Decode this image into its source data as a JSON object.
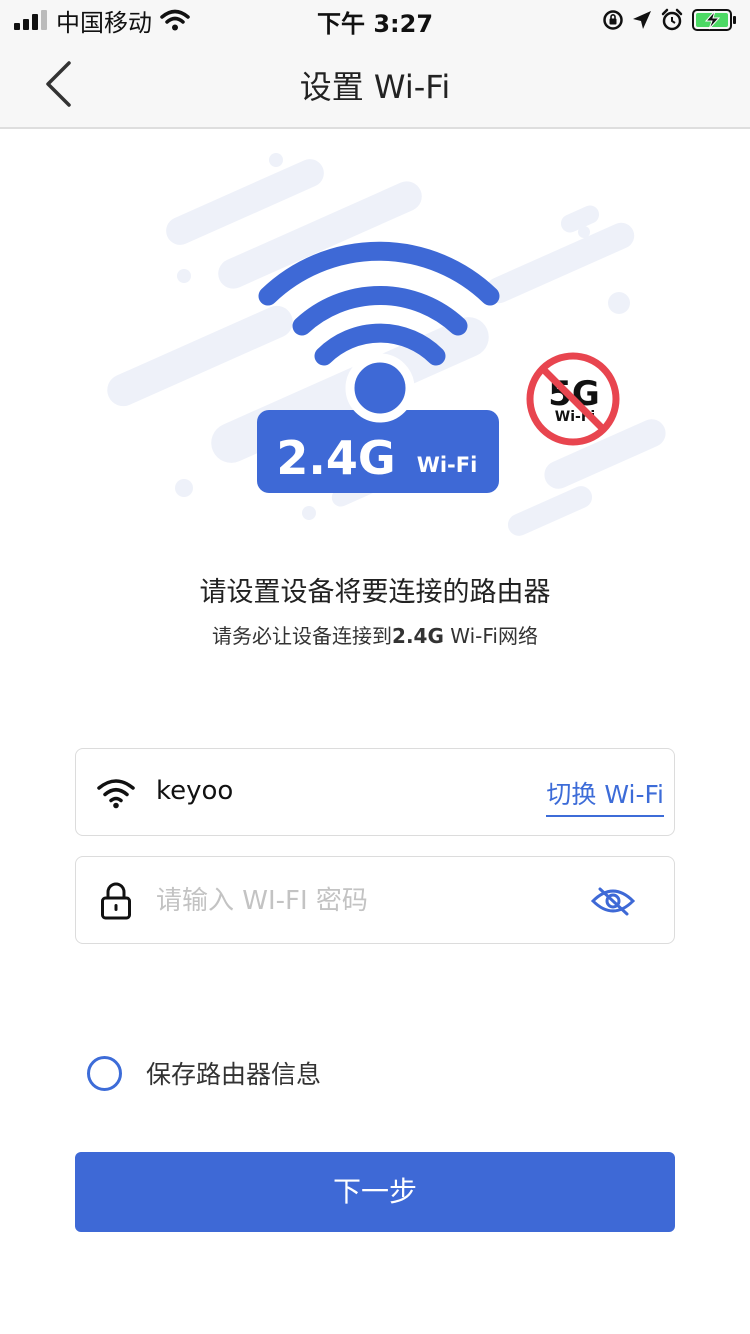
{
  "status_bar": {
    "carrier": "中国移动",
    "time": "下午 3:27"
  },
  "nav": {
    "title": "设置 Wi-Fi"
  },
  "illustration": {
    "badge_main": "2.4G",
    "badge_sub": "Wi-Fi",
    "forbidden_main": "5G",
    "forbidden_sub": "Wi-Fi"
  },
  "heading": "请设置设备将要连接的路由器",
  "subheading": {
    "prefix": "请务必让设备连接到",
    "band": "2.4G",
    "suffix": " Wi-Fi网络"
  },
  "ssid_field": {
    "value": "keyoo",
    "switch_label": "切换 Wi-Fi"
  },
  "password_field": {
    "value": "",
    "placeholder": "请输入 WI-FI 密码"
  },
  "remember": {
    "label": "保存路由器信息",
    "checked": false
  },
  "next_button": {
    "label": "下一步"
  },
  "colors": {
    "accent": "#3e69d6",
    "forbidden": "#e8454f",
    "decor": "#eef1f9"
  },
  "icons": [
    "signal-icon",
    "wifi-icon",
    "lock-rotation-icon",
    "location-icon",
    "alarm-icon",
    "battery-icon",
    "back-chevron-icon",
    "lock-icon",
    "eye-hidden-icon"
  ]
}
